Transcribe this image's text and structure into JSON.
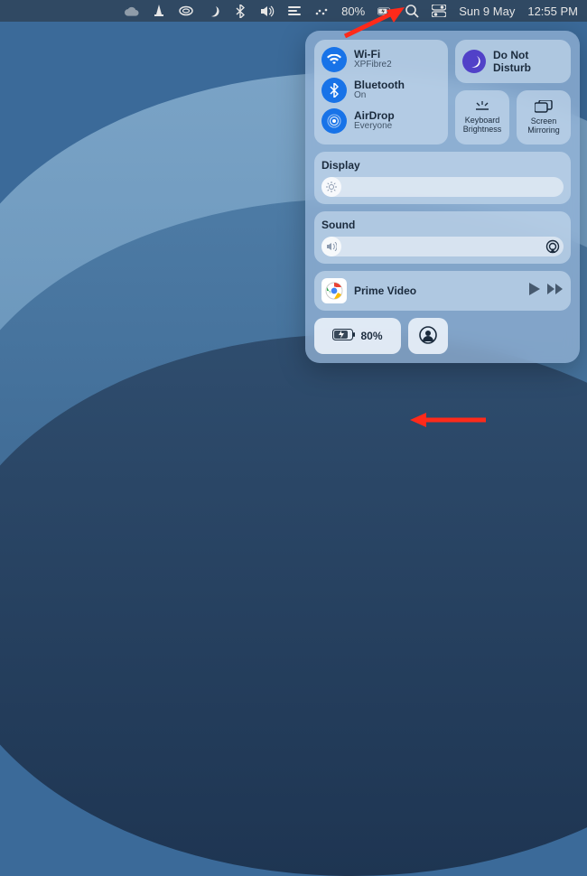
{
  "menubar": {
    "battery": "80%",
    "date": "Sun 9 May",
    "time": "12:55 PM"
  },
  "cc": {
    "wifi": {
      "name": "Wi-Fi",
      "sub": "XPFibre2"
    },
    "bt": {
      "name": "Bluetooth",
      "sub": "On"
    },
    "airdrop": {
      "name": "AirDrop",
      "sub": "Everyone"
    },
    "dnd": {
      "name": "Do Not\nDisturb"
    },
    "kb": "Keyboard\nBrightness",
    "mirror": "Screen\nMirroring",
    "display": "Display",
    "sound": "Sound",
    "media": {
      "app": "chrome",
      "title": "Prime Video"
    },
    "battery": "80%"
  }
}
